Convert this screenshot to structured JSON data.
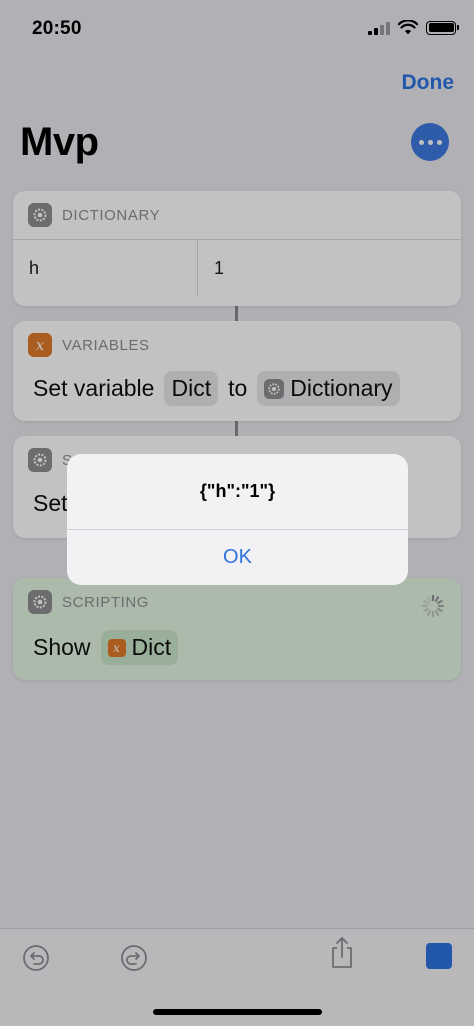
{
  "status_bar": {
    "time": "20:50"
  },
  "header": {
    "done_label": "Done",
    "title": "Mvp",
    "more_icon": "ellipsis-icon"
  },
  "cards": {
    "dictionary": {
      "label": "DICTIONARY",
      "icon": "gear-icon",
      "rows": [
        {
          "key": "h",
          "value": "1"
        }
      ]
    },
    "variables": {
      "label": "VARIABLES",
      "icon": "variable-icon",
      "action_text": "Set variable",
      "variable_token": "Dict",
      "connector_text": "to",
      "value_token": "Dictionary"
    },
    "scripting_partial": {
      "label": "S",
      "action_text": "Set"
    },
    "scripting": {
      "label": "SCRIPTING",
      "icon": "gear-icon",
      "action_text": "Show",
      "token": "Dict",
      "accent_color": "#e3f5e3"
    }
  },
  "alert": {
    "message": "{\"h\":\"1\"}",
    "ok_label": "OK"
  },
  "toolbar": {
    "undo_icon": "undo-icon",
    "redo_icon": "redo-icon",
    "share_icon": "share-icon",
    "stop_icon": "stop-icon"
  },
  "colors": {
    "accent": "#2f73e0",
    "variable_badge": "#e07b2a",
    "gear_badge": "#8e8e93"
  }
}
